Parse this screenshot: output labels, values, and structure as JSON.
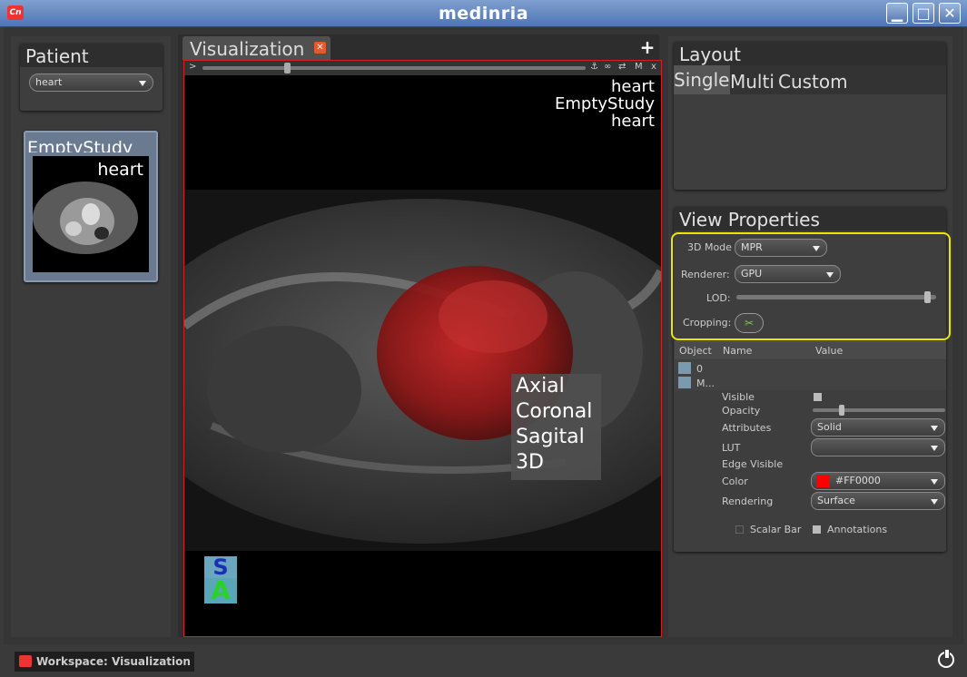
{
  "window": {
    "title": "medinria",
    "min_icon": "minimize-icon",
    "max_icon": "maximize-icon",
    "close_icon": "close-icon"
  },
  "patient": {
    "header": "Patient",
    "selected": "heart"
  },
  "study": {
    "label": "EmptyStudy",
    "thumb_label": "heart"
  },
  "visualization": {
    "tab_label": "Visualization",
    "toolbar_left": ">",
    "toolbar_right_m": "M",
    "toolbar_right_x": "x",
    "overlay": [
      "heart",
      "EmptyStudy",
      "heart"
    ],
    "orientation_menu": [
      "Axial",
      "Coronal",
      "Sagital",
      "3D"
    ],
    "cube_top": "S",
    "cube_front": "A"
  },
  "layout": {
    "header": "Layout",
    "tabs": [
      "Single",
      "Multi",
      "Custom"
    ]
  },
  "view_properties": {
    "header": "View Properties",
    "mode_label": "3D Mode",
    "mode_value": "MPR",
    "renderer_label": "Renderer:",
    "renderer_value": "GPU",
    "lod_label": "LOD:",
    "lod_level": 0.97,
    "cropping_label": "Cropping:",
    "columns": [
      "Object",
      "Name",
      "Value"
    ],
    "layers": [
      {
        "index": "0"
      },
      {
        "index": "M..."
      }
    ],
    "props": {
      "visible": "Visible",
      "opacity": "Opacity",
      "attributes": "Attributes",
      "attributes_value": "Solid",
      "lut": "LUT",
      "edge": "Edge Visible",
      "color": "Color",
      "color_value": "#FF0000",
      "rendering": "Rendering",
      "rendering_value": "Surface"
    },
    "scalar_bar": "Scalar Bar",
    "annotations": "Annotations",
    "highlight_color": "#e8e800"
  },
  "status": {
    "workspace": "Workspace: Visualization"
  }
}
